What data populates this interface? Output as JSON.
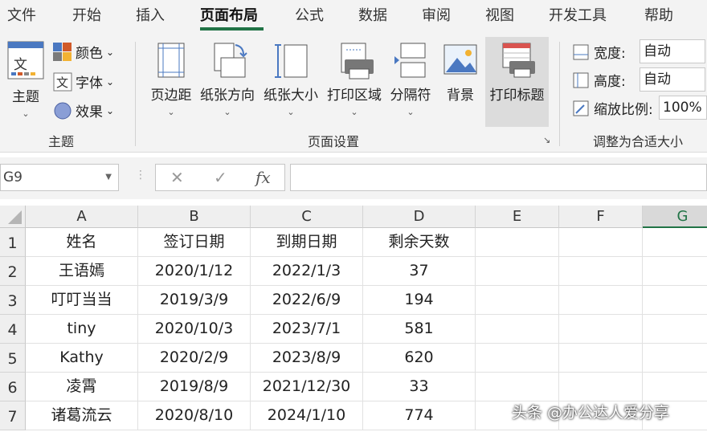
{
  "tabs": [
    "文件",
    "开始",
    "插入",
    "页面布局",
    "公式",
    "数据",
    "审阅",
    "视图",
    "开发工具",
    "帮助"
  ],
  "active_tab": "页面布局",
  "ribbon": {
    "themes_group": {
      "label": "主题",
      "theme_btn": "主题",
      "colors": "颜色",
      "fonts": "字体",
      "effects": "效果"
    },
    "page_setup_group": {
      "label": "页面设置",
      "buttons": [
        "页边距",
        "纸张方向",
        "纸张大小",
        "打印区域",
        "分隔符",
        "背景",
        "打印标题"
      ]
    },
    "scale_group": {
      "label": "调整为合适大小",
      "width_label": "宽度:",
      "width_value": "自动",
      "height_label": "高度:",
      "height_value": "自动",
      "scale_label": "缩放比例:",
      "scale_value": "100%"
    }
  },
  "formula_bar": {
    "name_box": "G9",
    "cancel": "✕",
    "enter": "✓",
    "fx": "fx",
    "formula": ""
  },
  "columns": [
    "A",
    "B",
    "C",
    "D",
    "E",
    "F",
    "G"
  ],
  "selected_column": "G",
  "rows": [
    {
      "num": "1",
      "cells": [
        "姓名",
        "签订日期",
        "到期日期",
        "剩余天数",
        "",
        "",
        ""
      ]
    },
    {
      "num": "2",
      "cells": [
        "王语嫣",
        "2020/1/12",
        "2022/1/3",
        "37",
        "",
        "",
        ""
      ]
    },
    {
      "num": "3",
      "cells": [
        "叮叮当当",
        "2019/3/9",
        "2022/6/9",
        "194",
        "",
        "",
        ""
      ]
    },
    {
      "num": "4",
      "cells": [
        "tiny",
        "2020/10/3",
        "2023/7/1",
        "581",
        "",
        "",
        ""
      ]
    },
    {
      "num": "5",
      "cells": [
        "Kathy",
        "2020/2/9",
        "2023/8/9",
        "620",
        "",
        "",
        ""
      ]
    },
    {
      "num": "6",
      "cells": [
        "凌霄",
        "2019/8/9",
        "2021/12/30",
        "33",
        "",
        "",
        ""
      ]
    },
    {
      "num": "7",
      "cells": [
        "诸葛流云",
        "2020/8/10",
        "2024/1/10",
        "774",
        "",
        "",
        ""
      ]
    }
  ],
  "watermark": "头条 @办公达人爱分享",
  "colors": {
    "accent": "#217346",
    "ribbon_bg": "#f3f3f3",
    "header_bg": "#efefef"
  }
}
